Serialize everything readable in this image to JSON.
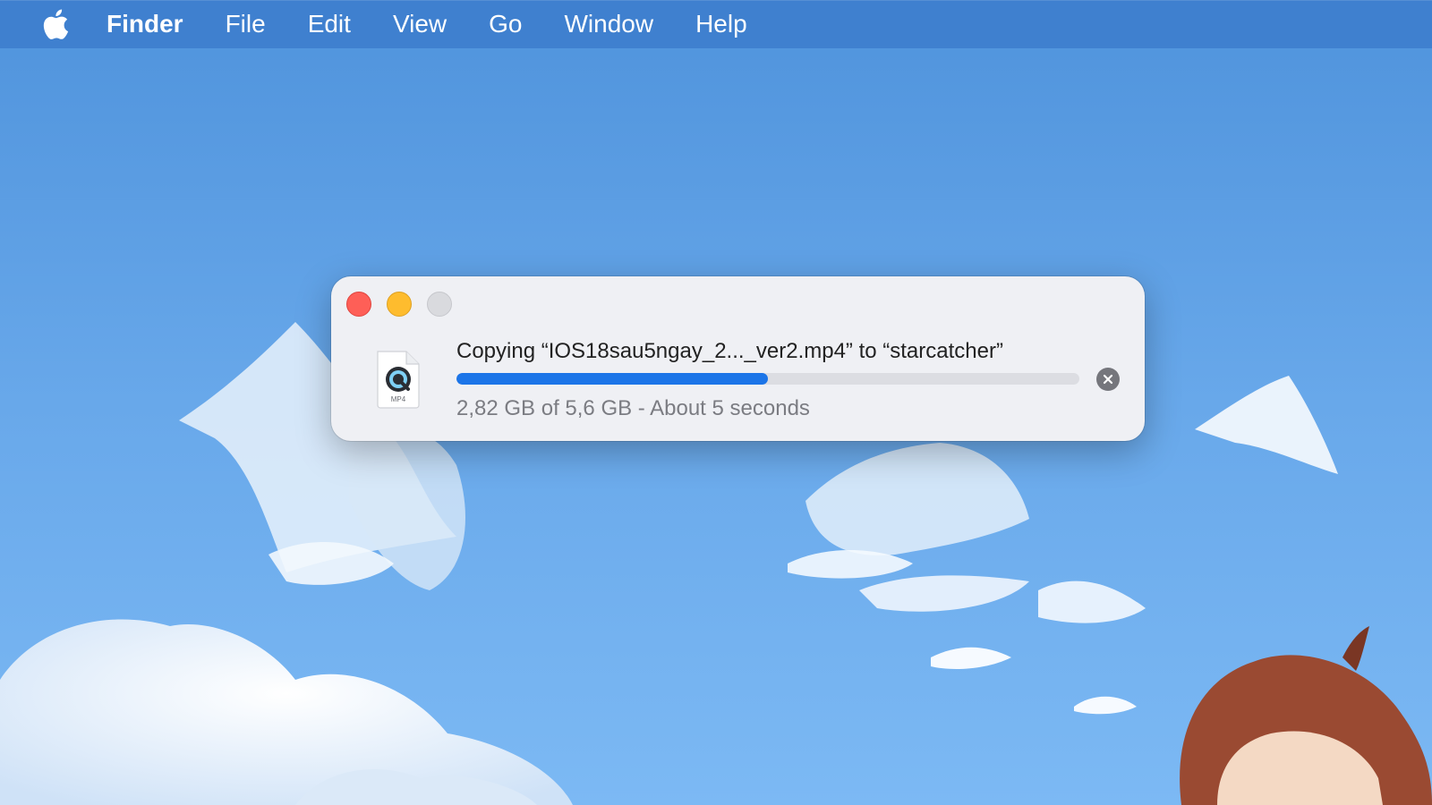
{
  "menubar": {
    "apple_icon": "apple-logo-icon",
    "items": [
      "Finder",
      "File",
      "Edit",
      "View",
      "Go",
      "Window",
      "Help"
    ]
  },
  "copy_dialog": {
    "title": "Copying “IOS18sau5ngay_2..._ver2.mp4” to “starcatcher”",
    "file_type": "MP4",
    "progress": 0.5,
    "status": "2,82 GB of 5,6 GB - About 5 seconds",
    "traffic_lights": [
      "close-icon",
      "minimize-icon",
      "zoom-icon"
    ],
    "cancel_icon": "close-circle-icon"
  },
  "colors": {
    "menubar": "#3f80cf",
    "dialog_bg": "#eff0f4",
    "progress": "#1c75e8",
    "close": "#fe5f57",
    "minimize": "#febc2e",
    "zoom_disabled": "#d9dade"
  }
}
